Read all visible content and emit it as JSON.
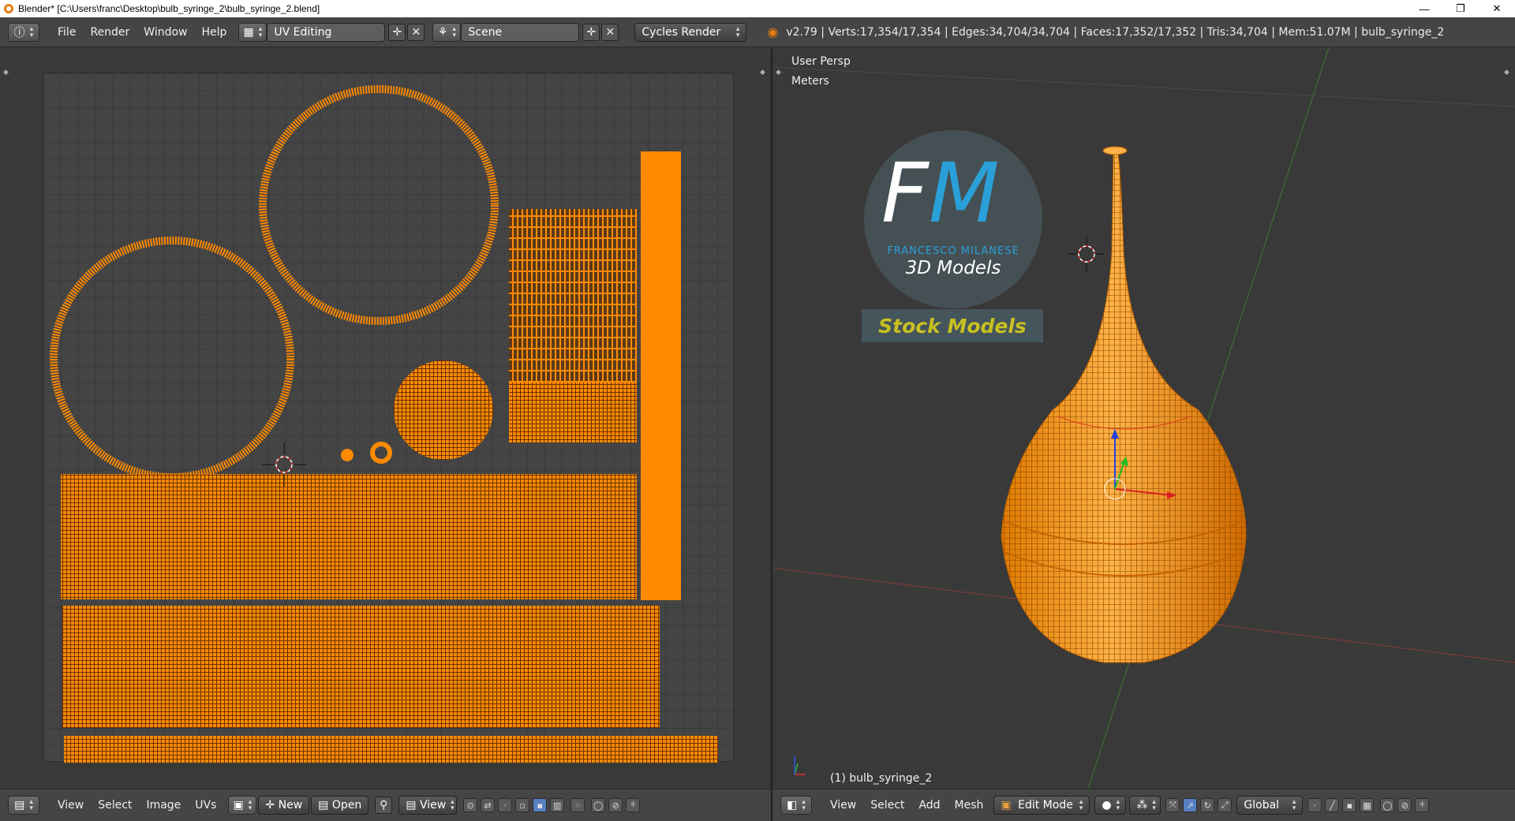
{
  "window": {
    "title": "Blender* [C:\\Users\\franc\\Desktop\\bulb_syringe_2\\bulb_syringe_2.blend]",
    "minimize": "—",
    "maximize": "❐",
    "close": "✕"
  },
  "header": {
    "menus": [
      "File",
      "Render",
      "Window",
      "Help"
    ],
    "screen_layout": "UV Editing",
    "scene": "Scene",
    "render_engine": "Cycles Render",
    "stats": "v2.79 | Verts:17,354/17,354 | Edges:34,704/34,704 | Faces:17,352/17,352 | Tris:34,704 | Mem:51.07M | bulb_syringe_2"
  },
  "uv_editor": {
    "menus": [
      "View",
      "Select",
      "Image",
      "UVs"
    ],
    "new_label": "New",
    "open_label": "Open",
    "view_label": "View"
  },
  "viewport": {
    "view_name": "User Persp",
    "units": "Meters",
    "object_label": "(1) bulb_syringe_2",
    "menus": [
      "View",
      "Select",
      "Add",
      "Mesh"
    ],
    "mode": "Edit Mode",
    "orientation": "Global",
    "logo": {
      "initials_f": "F",
      "initials_m": "M",
      "author": "FRANCESCO MILANESE",
      "subtitle": "3D Models",
      "badge": "Stock Models"
    }
  },
  "colors": {
    "accent": "#ff8a00",
    "logo_blue": "#2aa0d8",
    "badge_text": "#c8c020"
  }
}
